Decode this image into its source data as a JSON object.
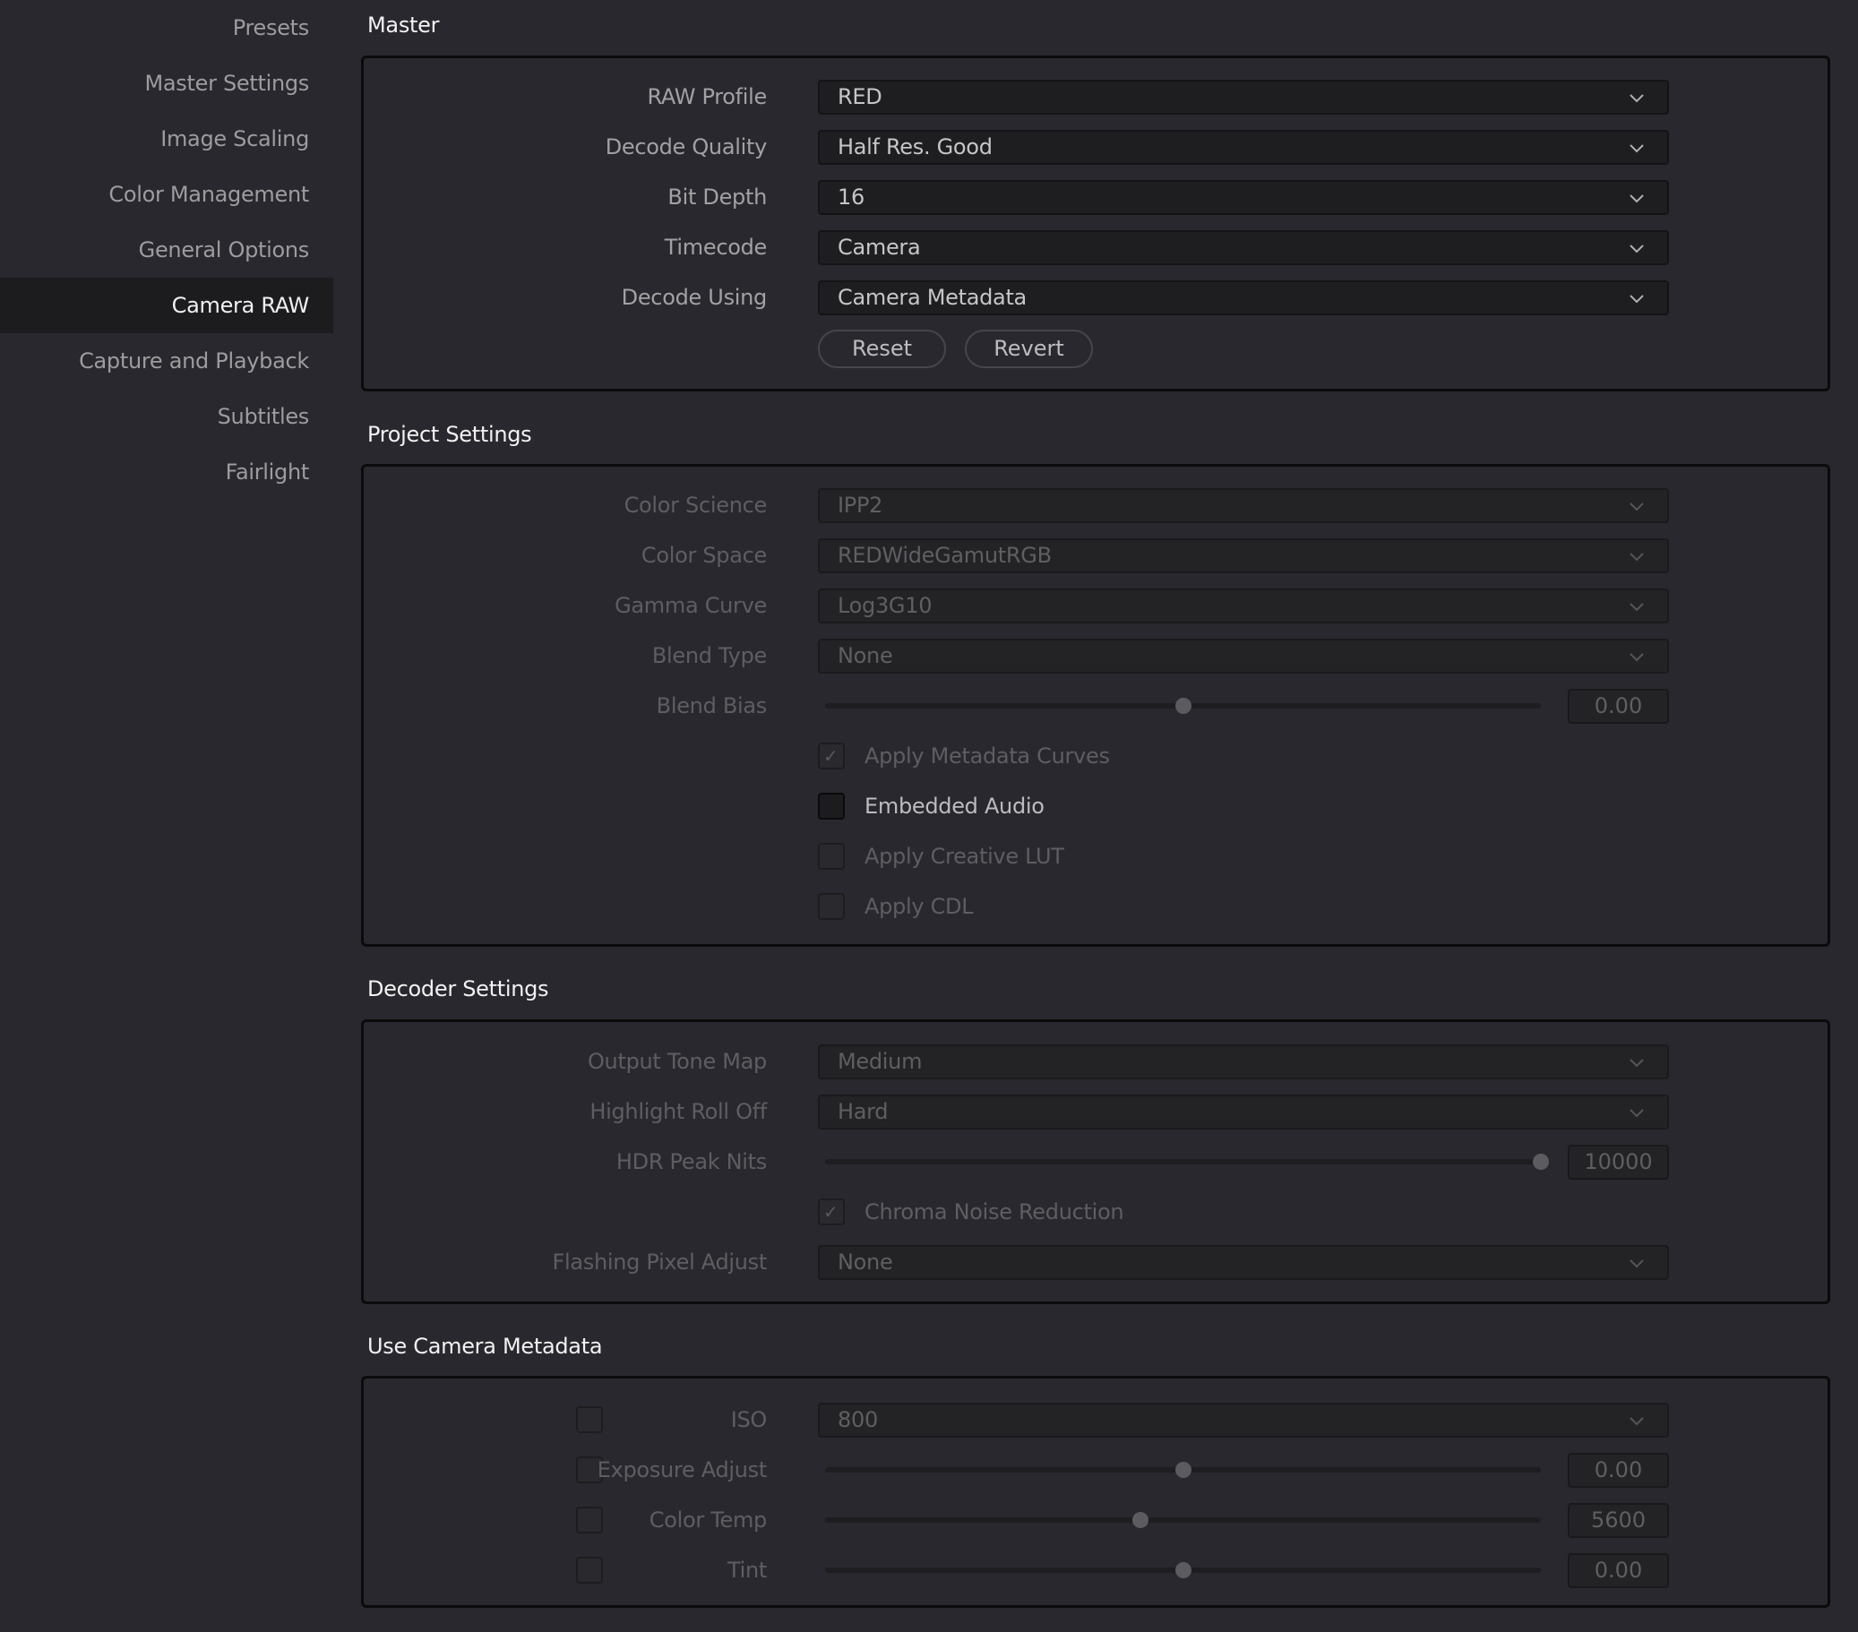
{
  "sidebar": {
    "selected": "Camera RAW",
    "items": [
      {
        "label": "Presets"
      },
      {
        "label": "Master Settings"
      },
      {
        "label": "Image Scaling"
      },
      {
        "label": "Color Management"
      },
      {
        "label": "General Options"
      },
      {
        "label": "Camera RAW"
      },
      {
        "label": "Capture and Playback"
      },
      {
        "label": "Subtitles"
      },
      {
        "label": "Fairlight"
      }
    ]
  },
  "master": {
    "title": "Master",
    "raw_profile": {
      "label": "RAW Profile",
      "value": "RED"
    },
    "decode_quality": {
      "label": "Decode Quality",
      "value": "Half Res. Good"
    },
    "bit_depth": {
      "label": "Bit Depth",
      "value": "16"
    },
    "timecode": {
      "label": "Timecode",
      "value": "Camera"
    },
    "decode_using": {
      "label": "Decode Using",
      "value": "Camera Metadata"
    },
    "reset_label": "Reset",
    "revert_label": "Revert"
  },
  "project": {
    "title": "Project Settings",
    "color_science": {
      "label": "Color Science",
      "value": "IPP2"
    },
    "color_space": {
      "label": "Color Space",
      "value": "REDWideGamutRGB"
    },
    "gamma_curve": {
      "label": "Gamma Curve",
      "value": "Log3G10"
    },
    "blend_type": {
      "label": "Blend Type",
      "value": "None"
    },
    "blend_bias": {
      "label": "Blend Bias",
      "value": "0.00",
      "position": 0.5
    },
    "apply_metadata_curves": {
      "label": "Apply Metadata Curves",
      "checked": true,
      "enabled": false
    },
    "embedded_audio": {
      "label": "Embedded Audio",
      "checked": false,
      "enabled": true
    },
    "apply_creative_lut": {
      "label": "Apply Creative LUT",
      "checked": false,
      "enabled": false
    },
    "apply_cdl": {
      "label": "Apply CDL",
      "checked": false,
      "enabled": false
    }
  },
  "decoder": {
    "title": "Decoder Settings",
    "output_tone_map": {
      "label": "Output Tone Map",
      "value": "Medium"
    },
    "highlight_roll_off": {
      "label": "Highlight Roll Off",
      "value": "Hard"
    },
    "hdr_peak_nits": {
      "label": "HDR Peak Nits",
      "value": "10000",
      "position": 1.0
    },
    "chroma_noise_reduction": {
      "label": "Chroma Noise Reduction",
      "checked": true,
      "enabled": false
    },
    "flashing_pixel_adjust": {
      "label": "Flashing Pixel Adjust",
      "value": "None"
    }
  },
  "camera_metadata": {
    "title": "Use Camera Metadata",
    "iso": {
      "label": "ISO",
      "value": "800",
      "checked": false
    },
    "exposure_adjust": {
      "label": "Exposure Adjust",
      "value": "0.00",
      "position": 0.5,
      "checked": false
    },
    "color_temp": {
      "label": "Color Temp",
      "value": "5600",
      "position": 0.44,
      "checked": false
    },
    "tint": {
      "label": "Tint",
      "value": "0.00",
      "position": 0.5,
      "checked": false
    }
  },
  "icons": {
    "dropdown": "chevron-down-icon",
    "check": "checkmark-icon"
  }
}
